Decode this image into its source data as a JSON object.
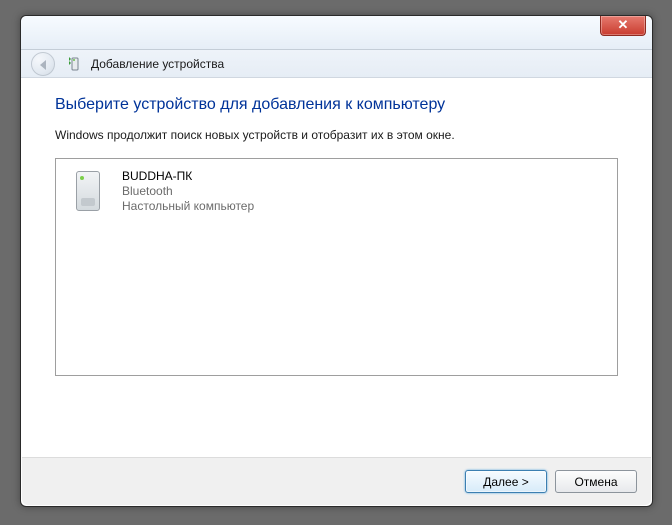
{
  "window": {
    "title": "Добавление устройства",
    "close_glyph": "✕"
  },
  "content": {
    "heading": "Выберите устройство для добавления к компьютеру",
    "subtext": "Windows продолжит поиск новых устройств и отобразит их в этом окне."
  },
  "devices": [
    {
      "name": "BUDDHA-ПК",
      "transport": "Bluetooth",
      "type": "Настольный компьютер"
    }
  ],
  "footer": {
    "next_label": "Далее >",
    "cancel_label": "Отмена"
  }
}
